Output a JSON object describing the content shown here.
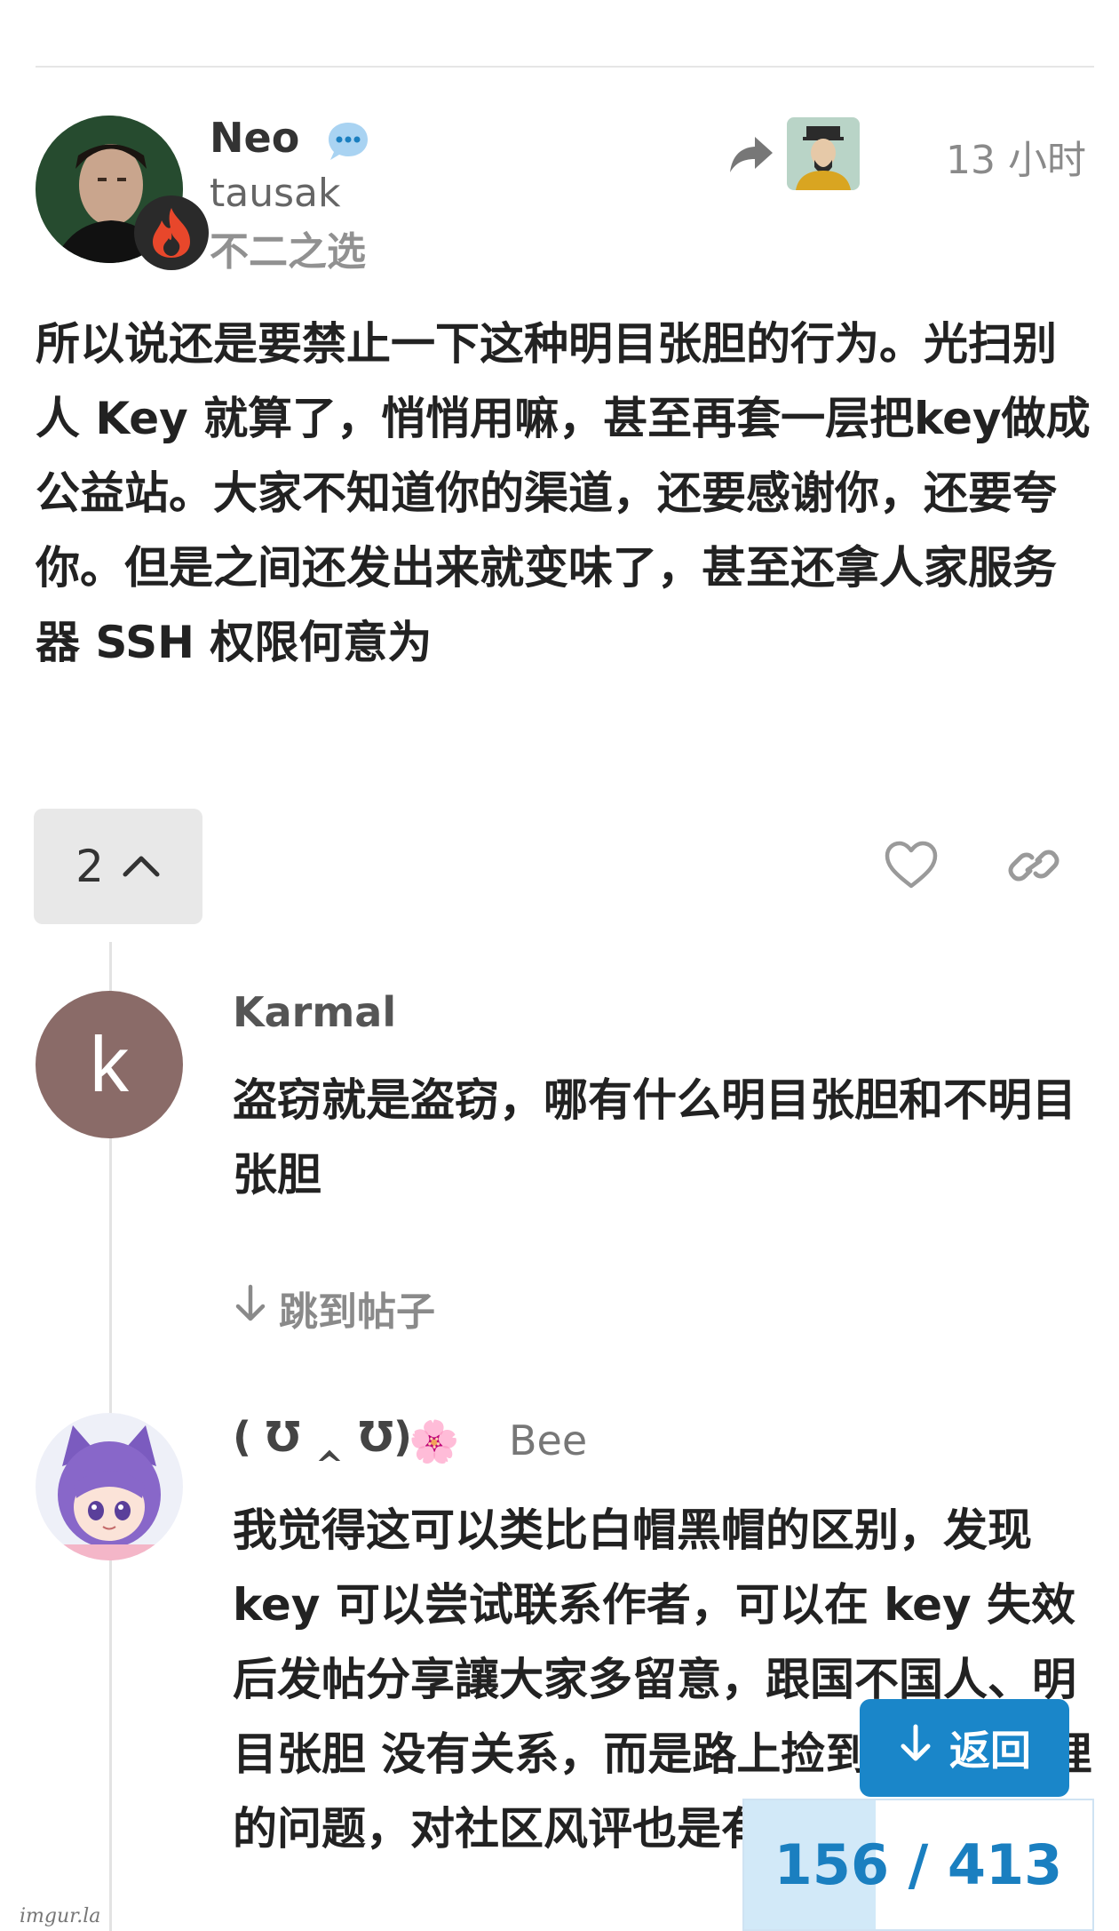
{
  "post": {
    "author": {
      "display_name": "Neo",
      "username": "tausak",
      "title": "不二之选",
      "flair_icon": "flame-icon",
      "status_icon": "chat-bubble-icon"
    },
    "reply_to_avatar": "emperor-avatar",
    "time": "13 小时",
    "body": "所以说还是要禁止一下这种明目张胆的行为。光扫别人 Key 就算了，悄悄用嘛，甚至再套一层把key做成公益站。大家不知道你的渠道，还要感谢你，还要夸你。但是之间还发出来就变味了，甚至还拿人家服务器 SSH 权限何意为",
    "reply_count": "2",
    "actions": [
      "heart-icon",
      "link-icon"
    ]
  },
  "replies": [
    {
      "avatar_letter": "k",
      "avatar_color": "#8a6b68",
      "name": "Karmal",
      "body": "盗窃就是盗窃，哪有什么明目张胆和不明目张胆",
      "jump_label": "跳到帖子"
    },
    {
      "name": "( Ʊ ‸ Ʊ)",
      "name_emoji": "🌸",
      "username": "Bee",
      "body": "我觉得这可以类比白帽黑帽的区别，发现 key 可以尝试联系作者，可以在 key 失效后发帖分享讓大家多留意，跟国不国人、明目张胆 没有关系，而是路上捡到钱怎么处理的问题，对社区风评也是有影响"
    }
  ],
  "controls": {
    "back_label": "返回",
    "progress_text": "156 / 413",
    "progress_current": 156,
    "progress_total": 413
  },
  "watermark": "imgur.la",
  "colors": {
    "accent": "#1a86c9",
    "progress_fill": "#d2e9f8",
    "flame": "#e8472b"
  }
}
